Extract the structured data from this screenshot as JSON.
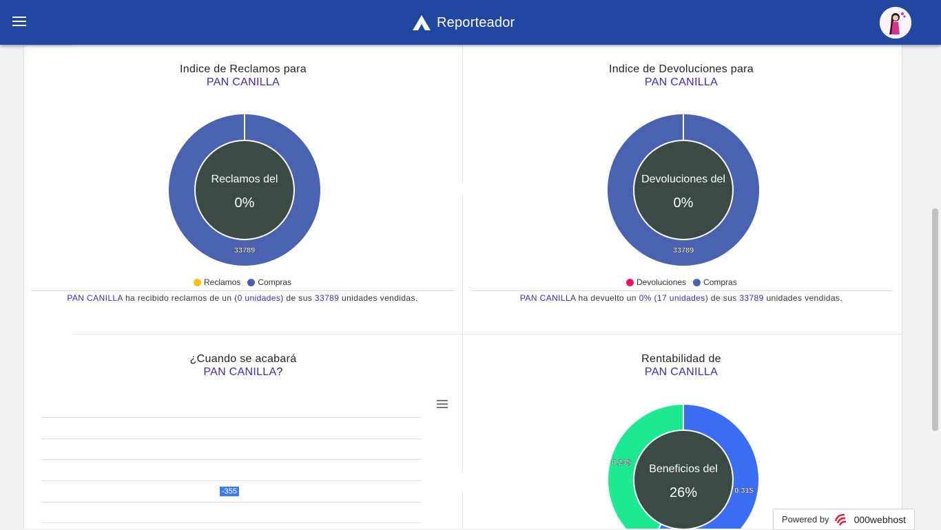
{
  "app": {
    "title": "Reporteador"
  },
  "panels": {
    "reclamos": {
      "title": "Indice de Reclamos para",
      "product": "PAN CANILLA",
      "center_label": "Reclamos del",
      "center_value": "0%",
      "slice_label": "33789",
      "legend": [
        "Reclamos",
        "Compras"
      ],
      "summary": {
        "product": "PAN CANILLA",
        "t1": "ha recibido reclamos de un",
        "v1": "(0 unidades)",
        "t2": "de sus",
        "v2": "33789",
        "t3": "unidades vendidas."
      }
    },
    "devoluciones": {
      "title": "Indice de Devoluciones para",
      "product": "PAN CANILLA",
      "center_label": "Devoluciones del",
      "center_value": "0%",
      "slice_label": "33789",
      "legend": [
        "Devoluciones",
        "Compras"
      ],
      "summary": {
        "product": "PAN CANILLA",
        "t1": "ha devuelto un",
        "v1": "0% (17 unidades)",
        "t2": "de sus",
        "v2": "33789",
        "t3": "unidades vendidas."
      }
    },
    "acabara": {
      "title": "¿Cuando se acabará",
      "product": "PAN CANILLA",
      "suffix": "?",
      "bar_label": "-355"
    },
    "rentabilidad": {
      "title": "Rentabilidad de",
      "product": "PAN CANILLA",
      "center_label": "Beneficios del",
      "center_value": "26%",
      "label_left": "0.23$",
      "label_right": "0.31$"
    }
  },
  "chart_data": [
    {
      "type": "pie",
      "title": "Indice de Reclamos para PAN CANILLA",
      "categories": [
        "Reclamos",
        "Compras"
      ],
      "values": [
        0,
        33789
      ],
      "colors": [
        "#f5c400",
        "#4a62b0"
      ]
    },
    {
      "type": "pie",
      "title": "Indice de Devoluciones para PAN CANILLA",
      "categories": [
        "Devoluciones",
        "Compras"
      ],
      "values": [
        17,
        33789
      ],
      "colors": [
        "#ee1166",
        "#4a62b0"
      ]
    },
    {
      "type": "bar",
      "title": "¿Cuando se acabará PAN CANILLA?",
      "values": [
        -355
      ]
    },
    {
      "type": "pie",
      "title": "Rentabilidad de PAN CANILLA",
      "categories": [
        "",
        ""
      ],
      "values": [
        0.31,
        0.23
      ],
      "colors": [
        "#3c6ef5",
        "#1de991"
      ]
    }
  ],
  "colors": {
    "topbar": "#2147a0",
    "accent_text": "#3d2bb0",
    "donut_center": "#3a4a45",
    "compras": "#4a62b0",
    "reclamos": "#f5c400",
    "devoluciones": "#ee1166",
    "rent_blue": "#3c6ef5",
    "rent_green": "#1de991"
  },
  "footer": {
    "powered_by": "Powered by",
    "host": "000webhost"
  }
}
